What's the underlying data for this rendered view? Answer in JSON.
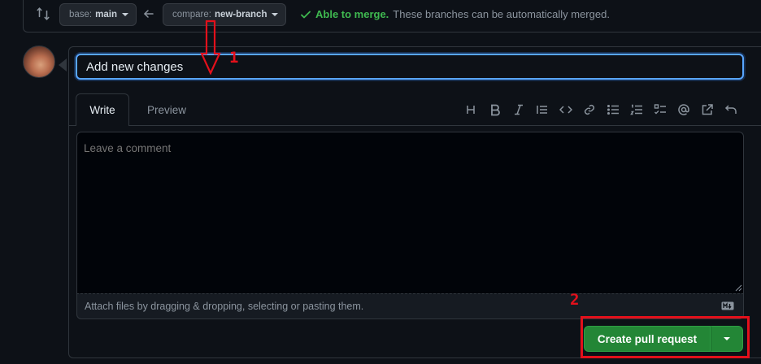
{
  "header": {
    "base_label": "base:",
    "base_value": "main",
    "compare_label": "compare:",
    "compare_value": "new-branch",
    "merge_ok": "Able to merge.",
    "merge_desc": "These branches can be automatically merged."
  },
  "form": {
    "title_value": "Add new changes",
    "tabs": [
      {
        "label": "Write"
      },
      {
        "label": "Preview"
      }
    ],
    "toolbar_icons": [
      "heading-icon",
      "bold-icon",
      "italic-icon",
      "quote-icon",
      "code-icon",
      "link-icon",
      "unordered-list-icon",
      "ordered-list-icon",
      "task-list-icon",
      "mention-icon",
      "reference-icon",
      "undo-icon"
    ],
    "comment_placeholder": "Leave a comment",
    "attach_text": "Attach files by dragging & dropping, selecting or pasting them.",
    "submit_label": "Create pull request"
  },
  "annotations": {
    "step1": "1",
    "step2": "2",
    "color": "#e3101b"
  },
  "colors": {
    "background": "#0d1117",
    "accent_focus": "#58a6ff",
    "success": "#3fb950",
    "button_green": "#238636"
  }
}
